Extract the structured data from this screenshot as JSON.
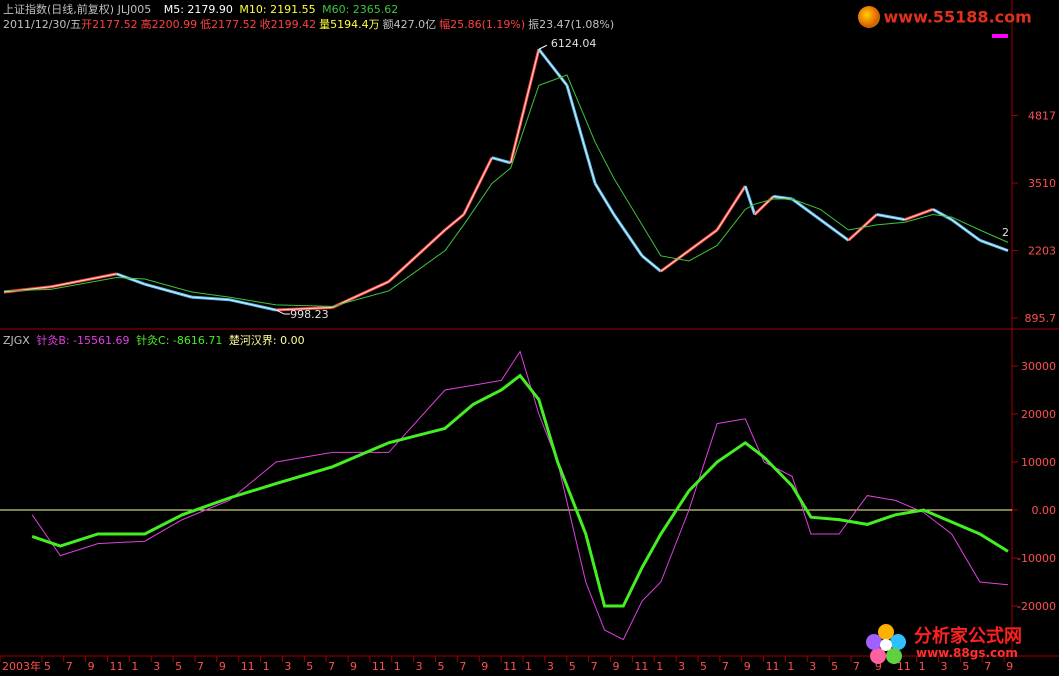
{
  "header": {
    "title": "上证指数(日线,前复权) JLJ005",
    "m5": "M5: 2179.90",
    "m10": "M10: 2191.55",
    "m60": "M60: 2365.62",
    "date": "2011/12/30/五",
    "open": "开2177.52",
    "high": "高2200.99",
    "low": "低2177.52",
    "close": "收2199.42",
    "volume": "量5194.4万",
    "amount": "额427.0亿",
    "change": "幅25.86(1.19%)",
    "amplitude": "振23.47(1.08%)"
  },
  "indicator_header": {
    "name": "ZJGX",
    "b": "针灸B: -15561.69",
    "c": "针灸C: -8616.71",
    "line": "楚河汉界: 0.00"
  },
  "price_annotations": {
    "high": "6124.04",
    "low": "998.23",
    "last_tag": "2"
  },
  "price_axis_labels": [
    "4817",
    "3510",
    "2203",
    "895.7"
  ],
  "indicator_axis_labels": [
    "30000",
    "20000",
    "10000",
    "0.00",
    "-10000",
    "-20000"
  ],
  "time_axis_labels": [
    "2003年",
    "5",
    "7",
    "9",
    "11",
    "1",
    "3",
    "5",
    "7",
    "9",
    "11",
    "1",
    "3",
    "5",
    "7",
    "9",
    "11",
    "1",
    "3",
    "5",
    "7",
    "9",
    "11",
    "1",
    "3",
    "5",
    "7",
    "9",
    "11",
    "1",
    "3",
    "5",
    "7",
    "9",
    "11",
    "1",
    "3",
    "5",
    "7",
    "9",
    "11",
    "1",
    "3",
    "5",
    "7",
    "9"
  ],
  "logos": {
    "top_url": "www.55188.com",
    "bottom_name": "分析家公式网",
    "bottom_url": "www.88gs.com"
  },
  "colors": {
    "price_up": "#ff4040",
    "price_down": "#4ec0ff",
    "ma": "#3cc43c",
    "ind_b": "#e040e0",
    "ind_c": "#44ee22",
    "zero": "#ffff99",
    "axis": "#a00000"
  },
  "chart_data": [
    {
      "type": "line",
      "x": [
        "2003-01",
        "2003-06",
        "2004-01",
        "2004-04",
        "2004-09",
        "2005-01",
        "2005-06",
        "2005-12",
        "2006-06",
        "2006-12",
        "2007-02",
        "2007-05",
        "2007-07",
        "2007-10",
        "2008-01",
        "2008-04",
        "2008-06",
        "2008-09",
        "2008-11",
        "2009-02",
        "2009-05",
        "2009-08",
        "2009-09",
        "2009-11",
        "2010-01",
        "2010-04",
        "2010-07",
        "2010-10",
        "2011-01",
        "2011-04",
        "2011-06",
        "2011-09",
        "2011-12"
      ],
      "series": [
        {
          "name": "",
          "values": [
            1400,
            1500,
            1750,
            1550,
            1300,
            1250,
            1050,
            1100,
            1600,
            2600,
            2900,
            4000,
            3900,
            6100,
            5400,
            3500,
            2900,
            2100,
            1800,
            2200,
            2600,
            3450,
            2900,
            3250,
            3200,
            2800,
            2400,
            2900,
            2800,
            3000,
            2800,
            2400,
            2200
          ]
        },
        {
          "name": "M60",
          "values": [
            1420,
            1450,
            1680,
            1650,
            1400,
            1300,
            1150,
            1120,
            1420,
            2200,
            2700,
            3500,
            3800,
            5400,
            5600,
            4300,
            3600,
            2700,
            2100,
            2000,
            2300,
            3000,
            3100,
            3200,
            3200,
            3000,
            2600,
            2700,
            2750,
            2900,
            2850,
            2600,
            2360
          ]
        }
      ],
      "ylim": [
        895.7,
        6124.04
      ],
      "yticks": [
        895.7,
        2203,
        3510,
        4817
      ]
    },
    {
      "type": "line",
      "x": [
        "2003-04",
        "2003-07",
        "2003-11",
        "2004-04",
        "2004-08",
        "2005-01",
        "2005-06",
        "2005-12",
        "2006-06",
        "2006-12",
        "2007-03",
        "2007-06",
        "2007-08",
        "2007-10",
        "2007-12",
        "2008-03",
        "2008-05",
        "2008-07",
        "2008-09",
        "2008-11",
        "2009-02",
        "2009-05",
        "2009-08",
        "2009-10",
        "2010-01",
        "2010-03",
        "2010-06",
        "2010-09",
        "2010-12",
        "2011-03",
        "2011-06",
        "2011-09",
        "2011-12"
      ],
      "series": [
        {
          "name": "针灸B",
          "values": [
            -1000,
            -9500,
            -7000,
            -6500,
            -2000,
            2000,
            10000,
            12000,
            12000,
            25000,
            26000,
            27000,
            33000,
            20000,
            10000,
            -15000,
            -25000,
            -27000,
            -19000,
            -15000,
            0,
            18000,
            19000,
            10000,
            7000,
            -5000,
            -5000,
            3000,
            2000,
            -500,
            -5000,
            -15000,
            -15561.69
          ]
        },
        {
          "name": "针灸C",
          "values": [
            -5500,
            -7500,
            -5000,
            -5000,
            -1000,
            2500,
            5500,
            9000,
            14000,
            17000,
            22000,
            25000,
            28000,
            23000,
            10000,
            -5000,
            -20000,
            -20000,
            -12000,
            -5000,
            4000,
            10000,
            14000,
            11000,
            5000,
            -1500,
            -2000,
            -3000,
            -1000,
            0,
            -2500,
            -5000,
            -8616.71
          ]
        },
        {
          "name": "楚河汉界",
          "values": [
            0,
            0,
            0,
            0,
            0,
            0,
            0,
            0,
            0,
            0,
            0,
            0,
            0,
            0,
            0,
            0,
            0,
            0,
            0,
            0,
            0,
            0,
            0,
            0,
            0,
            0,
            0,
            0,
            0,
            0,
            0,
            0,
            0
          ]
        }
      ],
      "ylim": [
        -20000,
        30000
      ],
      "yticks": [
        -20000,
        -10000,
        0,
        10000,
        20000,
        30000
      ]
    }
  ]
}
